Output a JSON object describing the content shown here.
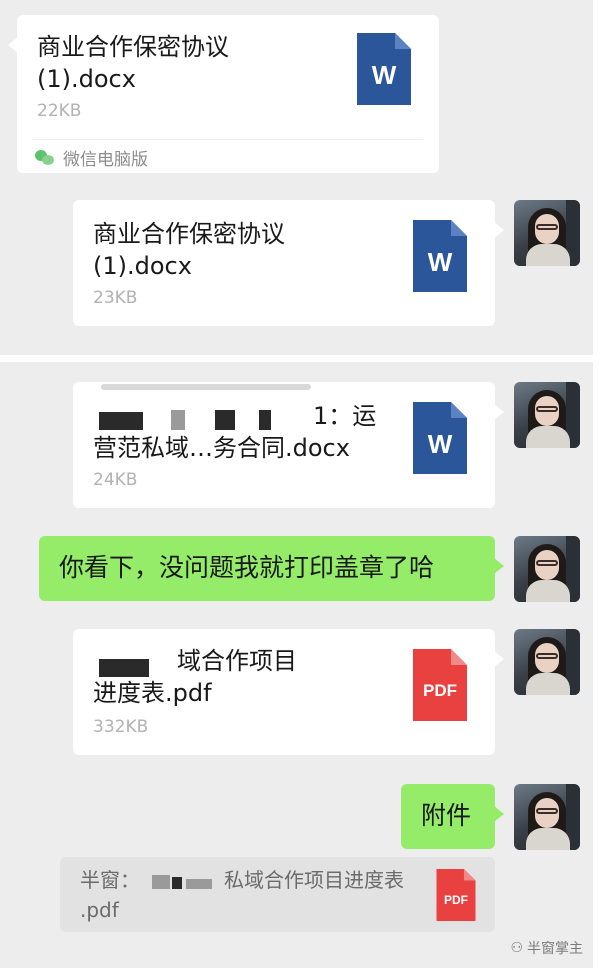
{
  "chat_top": {
    "received_file": {
      "name": "商业合作保密协议\n(1).docx",
      "size": "22KB",
      "source": "微信电脑版",
      "icon": "word-file-icon",
      "icon_letter": "W"
    },
    "sent_file": {
      "name": "商业合作保密协议\n(1).docx",
      "size": "23KB",
      "icon": "word-file-icon",
      "icon_letter": "W"
    }
  },
  "chat_bottom": {
    "file_contract": {
      "name_line1_visible": "1：运",
      "name_line2": "营范私域…务合同.docx",
      "size": "24KB",
      "icon_letter": "W"
    },
    "text_message": "你看下，没问题我就打印盖章了哈",
    "file_schedule": {
      "name_line1_visible": "域合作项目",
      "name_line2": "进度表.pdf",
      "size": "332KB",
      "icon_letter": "PDF"
    },
    "attachment_message": "附件",
    "quote": {
      "prefix": "半窗：",
      "visible_text": "私域合作项目进度表",
      "line2": ".pdf",
      "icon_letter": "PDF"
    }
  },
  "watermark": "半窗掌主",
  "colors": {
    "chat_background": "#ededed",
    "bubble_white": "#ffffff",
    "bubble_green": "#95ec69",
    "word_blue": "#2b579a",
    "pdf_red": "#e94040",
    "wechat_green": "#5dc36a"
  }
}
